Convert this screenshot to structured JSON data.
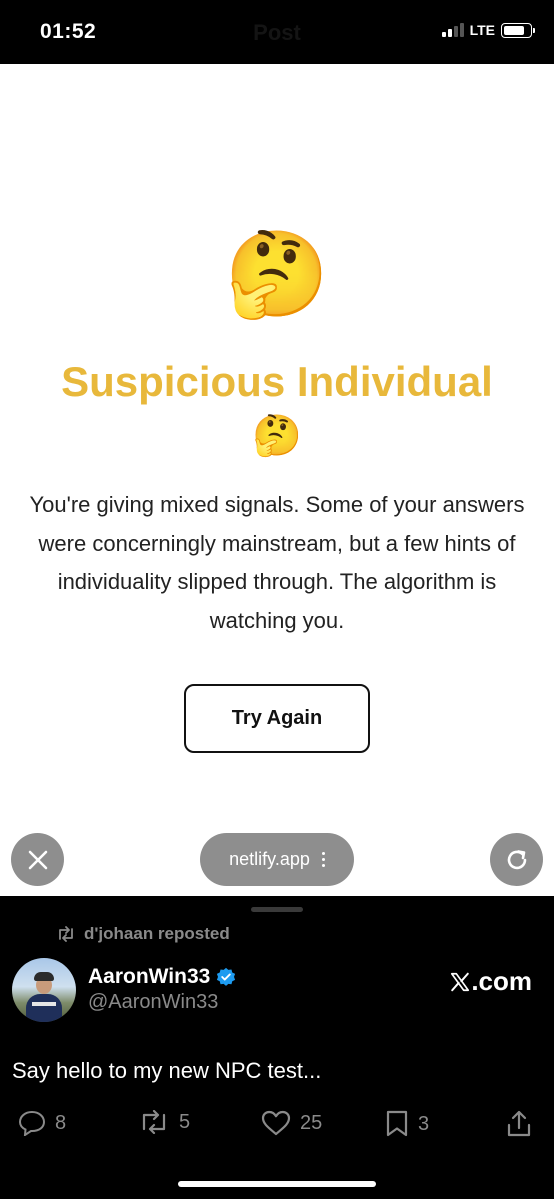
{
  "status_bar": {
    "time": "01:52",
    "ghost_title": "Post",
    "network": "LTE"
  },
  "quiz": {
    "emoji_large": "🤔",
    "title": "Suspicious Individual",
    "emoji_small": "🤔",
    "description": "You're giving mixed signals. Some of your answers were concerningly mainstream, but a few hints of individuality slipped through. The algorithm is watching you.",
    "try_again_label": "Try Again",
    "title_color": "#e8b83b"
  },
  "browser": {
    "url": "netlify.app",
    "close_icon": "close-icon",
    "reload_icon": "reload-icon"
  },
  "tweet": {
    "repost_label": "d'johaan reposted",
    "display_name": "AaronWin33",
    "handle": "@AaronWin33",
    "site_label": ".com",
    "text": "Say hello to my new NPC test...",
    "counts": {
      "replies": "8",
      "reposts": "5",
      "likes": "25",
      "bookmarks": "3"
    },
    "verified_color": "#1d9bf0"
  }
}
